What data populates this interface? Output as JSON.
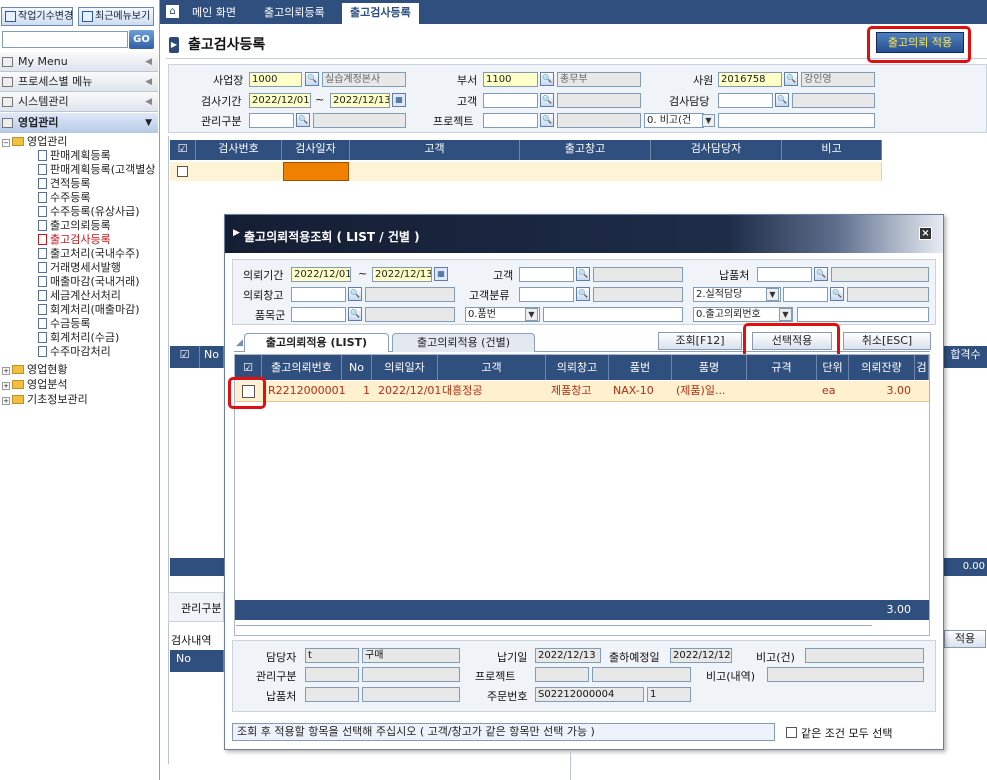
{
  "left": {
    "top_buttons": [
      "작업기수변경",
      "최근메뉴보기"
    ],
    "go_label": "GO",
    "menu_headers": [
      "My Menu",
      "프로세스별 메뉴",
      "시스템관리",
      "영업관리"
    ],
    "tree": {
      "root": "영업관리",
      "items": [
        "판매계획등록",
        "판매계획등록(고객별상",
        "견적등록",
        "수주등록",
        "수주등록(유상사급)",
        "출고의뢰등록",
        "출고검사등록",
        "출고처리(국내수주)",
        "거래명세서발행",
        "매출마감(국내거래)",
        "세금계산서처리",
        "회계처리(매출마감)",
        "수금등록",
        "회계처리(수금)",
        "수주마감처리"
      ],
      "groups": [
        "영업현황",
        "영업분석",
        "기초정보관리"
      ]
    }
  },
  "tabs": [
    "메인 화면",
    "출고의뢰등록",
    "출고검사등록"
  ],
  "page": {
    "title": "출고검사등록",
    "apply_button": "출고의뢰 적용"
  },
  "cond": {
    "company_label": "사업장",
    "company_code": "1000",
    "company_name": "실습계정본사",
    "dept_label": "부서",
    "dept_code": "1100",
    "dept_name": "총무부",
    "emp_label": "사원",
    "emp_code": "2016758",
    "emp_name": "강인영",
    "period_label": "검사기간",
    "period_from": "2022/12/01",
    "tilde": "~",
    "period_to": "2022/12/13",
    "customer_label": "고객",
    "inspector_label": "검사담당",
    "mgmt_label": "관리구분",
    "project_label": "프로젝트",
    "remark_select": "0. 비고(건"
  },
  "main_grid": {
    "headers": [
      "검사번호",
      "검사일자",
      "고객",
      "출고창고",
      "검사담당자",
      "비고"
    ],
    "lower_header_no": "No",
    "lower_right_header": "합격수",
    "lower_right_value": "0.00",
    "mgmt_label": "관리구분",
    "detail_label": "검사내역",
    "detail_no": "No",
    "detail_apply": "적용"
  },
  "modal": {
    "title": "출고의뢰적용조회 ( LIST / 건별 )",
    "cond": {
      "period_label": "의뢰기간",
      "period_from": "2022/12/01",
      "tilde": "~",
      "period_to": "2022/12/13",
      "customer_label": "고객",
      "delivery_label": "납품처",
      "warehouse_label": "의뢰창고",
      "customer_class_label": "고객분류",
      "owner_select": "2.실적담당",
      "item_group_label": "품목군",
      "item_select": "0.품번",
      "request_select": "0.출고의뢰번호"
    },
    "tabs": [
      "출고의뢰적용 (LIST)",
      "출고의뢰적용 (건별)"
    ],
    "buttons": {
      "search": "조회[F12]",
      "apply": "선택적용",
      "cancel": "취소[ESC]"
    },
    "grid": {
      "headers": [
        "출고의뢰번호",
        "No",
        "의뢰일자",
        "고객",
        "의뢰창고",
        "품번",
        "품명",
        "규격",
        "단위",
        "의뢰잔량"
      ],
      "row": {
        "request_no": "R2212000001",
        "no": "1",
        "date": "2022/12/01",
        "customer": "대흥정공",
        "warehouse": "제품창고",
        "item_code": "NAX-10",
        "item_name": "(제품)일...",
        "spec": "",
        "unit": "ea",
        "qty": "3.00"
      },
      "total": "3.00"
    },
    "footer": {
      "manager_label": "담당자",
      "manager_code": "t",
      "manager_name": "구매",
      "due_label": "납기일",
      "due": "2022/12/13",
      "ship_label": "출하예정일",
      "ship": "2022/12/12",
      "remark_label": "비고(건)",
      "mgmt_label": "관리구분",
      "project_label": "프로젝트",
      "remark_detail_label": "비고(내역)",
      "delivery_label": "납품처",
      "order_label": "주문번호",
      "order_no": "S02212000004",
      "order_seq": "1"
    },
    "status": "조회 후 적용할 항목을 선택해 주십시오 ( 고객/창고가 같은 항목만 선택 가능 )",
    "same_cond_label": "같은 조건 모두 선택"
  }
}
